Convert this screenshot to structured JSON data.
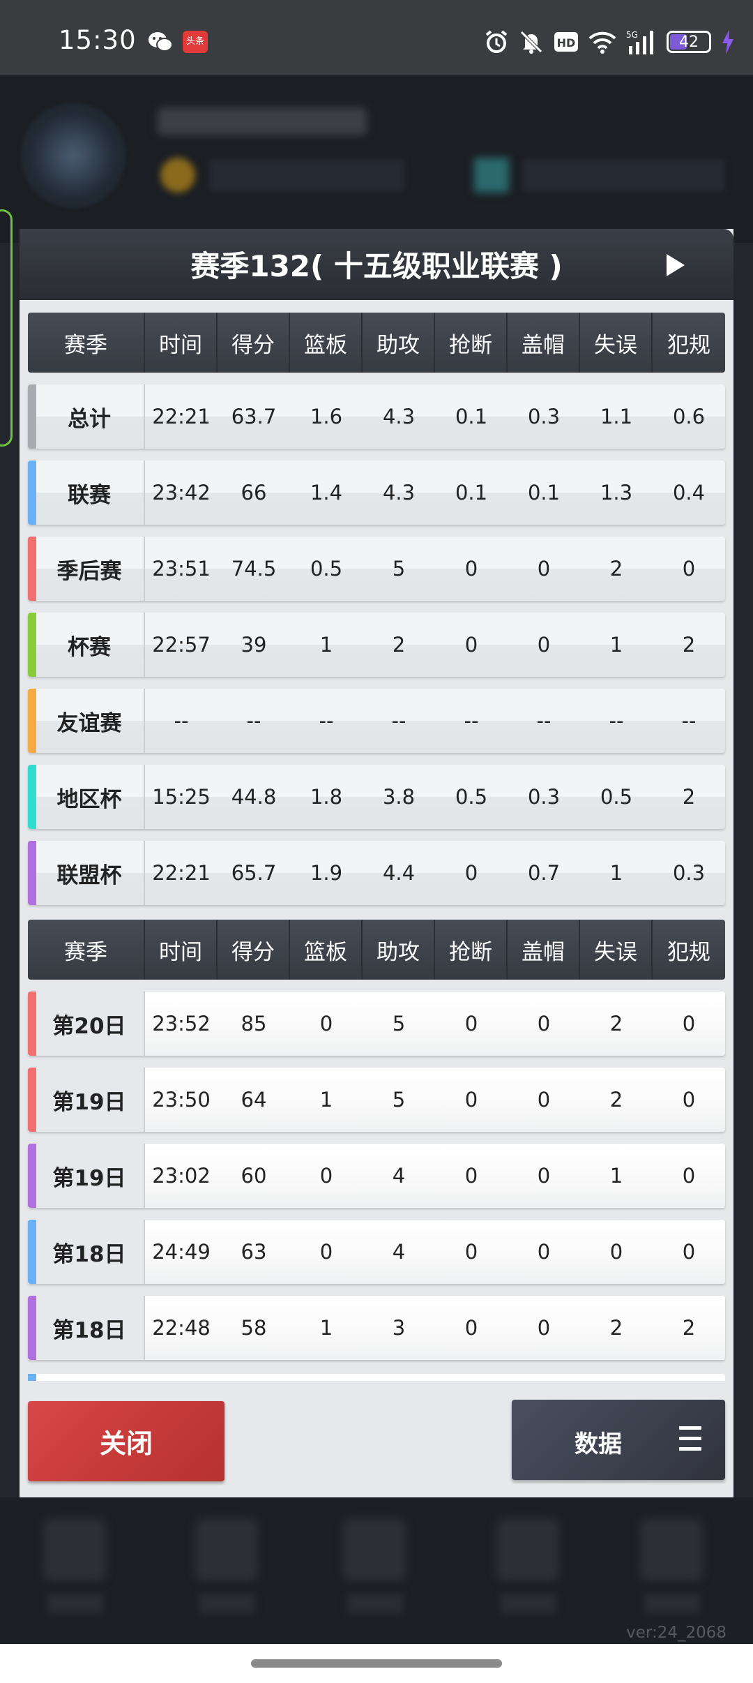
{
  "status_bar": {
    "time": "15:30",
    "battery": "42",
    "icons": [
      "wechat-icon",
      "toutiao-icon",
      "alarm-icon",
      "mute-icon",
      "hd-icon",
      "wifi-icon",
      "5g-signal-icon",
      "battery-icon",
      "charging-icon"
    ]
  },
  "modal": {
    "title": "赛季132( 十五级职业联赛 )",
    "columns": [
      "赛季",
      "时间",
      "得分",
      "篮板",
      "助攻",
      "抢断",
      "盖帽",
      "失误",
      "犯规"
    ],
    "season_rows": [
      {
        "label": "总计",
        "accent": "#a8abb0",
        "values": [
          "22:21",
          "63.7",
          "1.6",
          "4.3",
          "0.1",
          "0.3",
          "1.1",
          "0.6"
        ]
      },
      {
        "label": "联赛",
        "accent": "#6ab0f5",
        "values": [
          "23:42",
          "66",
          "1.4",
          "4.3",
          "0.1",
          "0.1",
          "1.3",
          "0.4"
        ]
      },
      {
        "label": "季后赛",
        "accent": "#f07070",
        "values": [
          "23:51",
          "74.5",
          "0.5",
          "5",
          "0",
          "0",
          "2",
          "0"
        ]
      },
      {
        "label": "杯赛",
        "accent": "#88cc3c",
        "values": [
          "22:57",
          "39",
          "1",
          "2",
          "0",
          "0",
          "1",
          "2"
        ]
      },
      {
        "label": "友谊赛",
        "accent": "#f5aa44",
        "values": [
          "--",
          "--",
          "--",
          "--",
          "--",
          "--",
          "--",
          "--"
        ]
      },
      {
        "label": "地区杯",
        "accent": "#2fdcd0",
        "values": [
          "15:25",
          "44.8",
          "1.8",
          "3.8",
          "0.5",
          "0.3",
          "0.5",
          "2"
        ]
      },
      {
        "label": "联盟杯",
        "accent": "#b070e0",
        "values": [
          "22:21",
          "65.7",
          "1.9",
          "4.4",
          "0",
          "0.7",
          "1",
          "0.3"
        ]
      }
    ],
    "game_rows": [
      {
        "label": "第20日",
        "accent": "#f07070",
        "values": [
          "23:52",
          "85",
          "0",
          "5",
          "0",
          "0",
          "2",
          "0"
        ]
      },
      {
        "label": "第19日",
        "accent": "#f07070",
        "values": [
          "23:50",
          "64",
          "1",
          "5",
          "0",
          "0",
          "2",
          "0"
        ]
      },
      {
        "label": "第19日",
        "accent": "#b070e0",
        "values": [
          "23:02",
          "60",
          "0",
          "4",
          "0",
          "0",
          "1",
          "0"
        ]
      },
      {
        "label": "第18日",
        "accent": "#6ab0f5",
        "values": [
          "24:49",
          "63",
          "0",
          "4",
          "0",
          "0",
          "0",
          "0"
        ]
      },
      {
        "label": "第18日",
        "accent": "#b070e0",
        "values": [
          "22:48",
          "58",
          "1",
          "3",
          "0",
          "0",
          "2",
          "2"
        ]
      }
    ],
    "close_label": "关闭",
    "data_label": "数据"
  },
  "version": "ver:24_2068"
}
